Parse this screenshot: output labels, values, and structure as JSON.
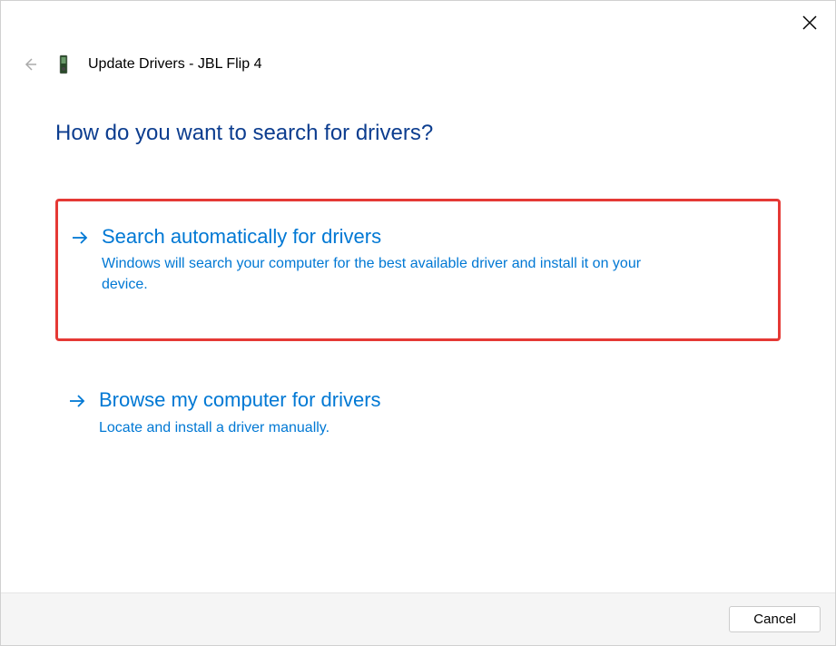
{
  "header": {
    "title": "Update Drivers - JBL Flip 4"
  },
  "heading": "How do you want to search for drivers?",
  "options": [
    {
      "title": "Search automatically for drivers",
      "description": "Windows will search your computer for the best available driver and install it on your device."
    },
    {
      "title": "Browse my computer for drivers",
      "description": "Locate and install a driver manually."
    }
  ],
  "footer": {
    "cancel_label": "Cancel"
  }
}
